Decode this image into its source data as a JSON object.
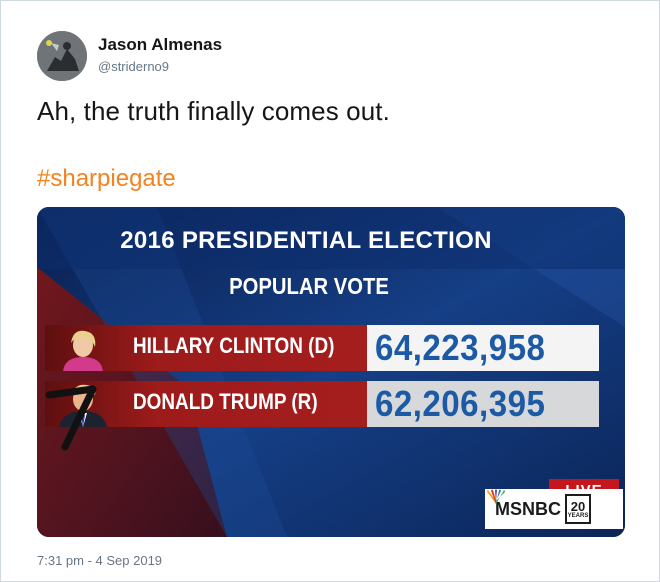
{
  "tweet": {
    "display_name": "Jason Almenas",
    "handle": "@striderno9",
    "text": "Ah, the truth finally comes out.",
    "hashtag": "#sharpiegate",
    "timestamp": "7:31 pm - 4 Sep 2019",
    "hashtag_color": "#f5821f"
  },
  "media": {
    "title": "2016 PRESIDENTIAL ELECTION",
    "subtitle": "POPULAR VOTE",
    "candidates": [
      {
        "name": "HILLARY CLINTON (D)",
        "votes": "64,223,958"
      },
      {
        "name": "DONALD TRUMP (R)",
        "votes": "62,206,395"
      }
    ],
    "live_label": "LIVE",
    "network": "MSNBC",
    "years_number": "20",
    "years_word": "YEARS",
    "vote_color": "#1c5aa6",
    "banner_red": "#a51e1e",
    "background_blue": "#0b2a64"
  }
}
